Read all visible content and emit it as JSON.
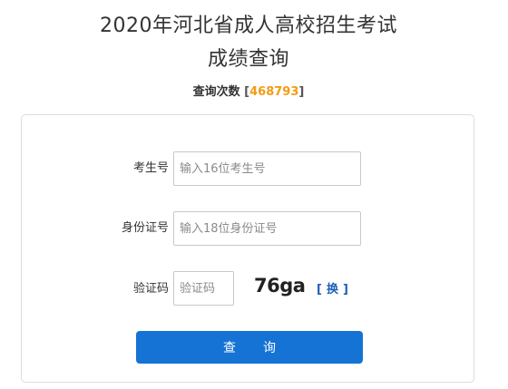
{
  "header": {
    "title_line1": "2020年河北省成人高校招生考试",
    "title_line2": "成绩查询"
  },
  "query_count": {
    "label": "查询次数",
    "open_bracket": "[",
    "value": "468793",
    "close_bracket": "]",
    "value_color": "#f39c12"
  },
  "form": {
    "exam_number": {
      "label": "考生号",
      "value": "",
      "placeholder": "输入16位考生号"
    },
    "id_number": {
      "label": "身份证号",
      "value": "",
      "placeholder": "输入18位身份证号"
    },
    "captcha": {
      "label": "验证码",
      "value": "",
      "placeholder": "验证码",
      "image_text": "76ga",
      "refresh_open": "[",
      "refresh_label": "换",
      "refresh_close": "]"
    },
    "submit_label": "查询",
    "accent_color": "#1473d4"
  }
}
